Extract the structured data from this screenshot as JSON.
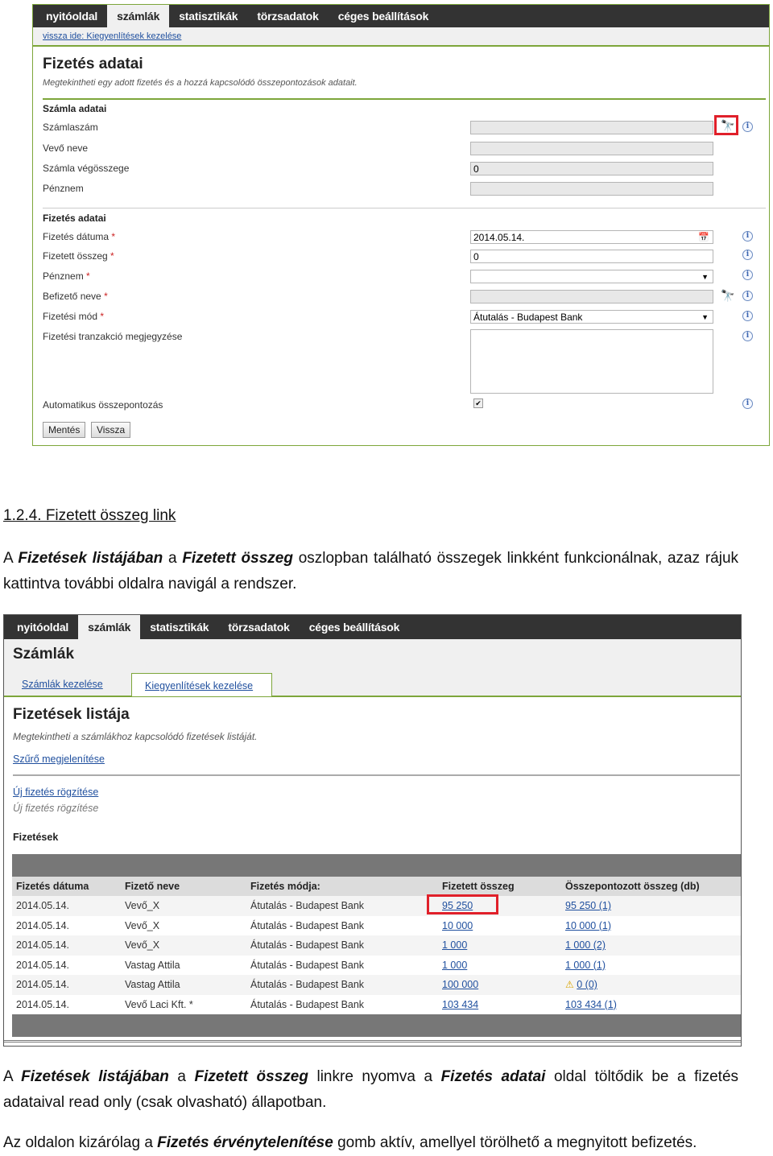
{
  "screenshot1": {
    "nav": [
      "nyitóoldal",
      "számlák",
      "statisztikák",
      "törzsadatok",
      "céges beállítások"
    ],
    "back_link": "vissza ide: Kiegyenlítések kezelése",
    "title": "Fizetés adatai",
    "subtitle": "Megtekintheti egy adott fizetés és a hozzá kapcsolódó összepontozások adatait.",
    "section_invoice": "Számla adatai",
    "invoice_fields": [
      {
        "label": "Számlaszám",
        "value": ""
      },
      {
        "label": "Vevő neve",
        "value": ""
      },
      {
        "label": "Számla végösszege",
        "value": "0"
      },
      {
        "label": "Pénznem",
        "value": ""
      }
    ],
    "section_payment": "Fizetés adatai",
    "payment_fields": [
      {
        "label": "Fizetés dátuma",
        "required": "*",
        "value": "2014.05.14."
      },
      {
        "label": "Fizetett összeg",
        "required": "*",
        "value": "0"
      },
      {
        "label": "Pénznem",
        "required": "*",
        "value": ""
      },
      {
        "label": "Befizető neve",
        "required": "*",
        "value": ""
      },
      {
        "label": "Fizetési mód",
        "required": "*",
        "value": "Átutalás - Budapest Bank"
      },
      {
        "label": "Fizetési tranzakció megjegyzése",
        "required": "",
        "value": ""
      }
    ],
    "auto_label": "Automatikus összepontozás",
    "auto_checked": true,
    "save_button": "Mentés",
    "back_button": "Vissza"
  },
  "heading": "1.2.4. Fizetett összeg link",
  "para1": {
    "p1": "A ",
    "b1": "Fizetések listájában",
    "p2": " a ",
    "b2": "Fizetett összeg",
    "p3": " oszlopban található összegek linkként funkcionálnak, azaz rájuk kattintva további oldalra navigál a rendszer."
  },
  "screenshot2": {
    "nav": [
      "nyitóoldal",
      "számlák",
      "statisztikák",
      "törzsadatok",
      "céges beállítások"
    ],
    "page_title": "Számlák",
    "subtabs": [
      "Számlák kezelése",
      "Kiegyenlítések kezelése"
    ],
    "list_title": "Fizetések listája",
    "list_subtitle": "Megtekintheti a számlákhoz kapcsolódó fizetések listáját.",
    "filter_link": "Szűrő megjelenítése",
    "new_payment_link": "Új fizetés rögzítése",
    "new_payment_text": "Új fizetés rögzítése",
    "table_title": "Fizetések",
    "columns": [
      "Fizetés dátuma",
      "Fizető neve",
      "Fizetés módja:",
      "Fizetett összeg",
      "Összepontozott összeg (db)"
    ],
    "rows": [
      {
        "date": "2014.05.14.",
        "payer": "Vevő_X",
        "method": "Átutalás - Budapest Bank",
        "amount": "95 250",
        "matched": "95 250 (1)",
        "warn": false
      },
      {
        "date": "2014.05.14.",
        "payer": "Vevő_X",
        "method": "Átutalás - Budapest Bank",
        "amount": "10 000",
        "matched": "10 000 (1)",
        "warn": false
      },
      {
        "date": "2014.05.14.",
        "payer": "Vevő_X",
        "method": "Átutalás - Budapest Bank",
        "amount": "1 000",
        "matched": "1 000 (2)",
        "warn": false
      },
      {
        "date": "2014.05.14.",
        "payer": "Vastag Attila",
        "method": "Átutalás - Budapest Bank",
        "amount": "1 000",
        "matched": "1 000 (1)",
        "warn": false
      },
      {
        "date": "2014.05.14.",
        "payer": "Vastag Attila",
        "method": "Átutalás - Budapest Bank",
        "amount": "100 000",
        "matched": "0 (0)",
        "warn": true
      },
      {
        "date": "2014.05.14.",
        "payer": "Vevő Laci Kft. *",
        "method": "Átutalás - Budapest Bank",
        "amount": "103 434",
        "matched": "103 434 (1)",
        "warn": false
      }
    ]
  },
  "para2": {
    "p1": "A ",
    "b1": "Fizetések listájában",
    "p2": " a ",
    "b2": "Fizetett összeg",
    "p3": " linkre nyomva a ",
    "b3": "Fizetés adatai",
    "p4": " oldal töltődik be a fizetés adataival read only (csak olvasható) állapotban."
  },
  "para3": {
    "p1": "Az oldalon kizárólag a ",
    "b1": "Fizetés érvénytelenítése",
    "p2": " gomb aktív, amellyel törölhető a megnyitott befizetés."
  },
  "colors": {
    "nav_bg": "#333333",
    "accent_green": "#7da63a",
    "highlight_red": "#e0202a",
    "link_blue": "#1f4f9e"
  }
}
